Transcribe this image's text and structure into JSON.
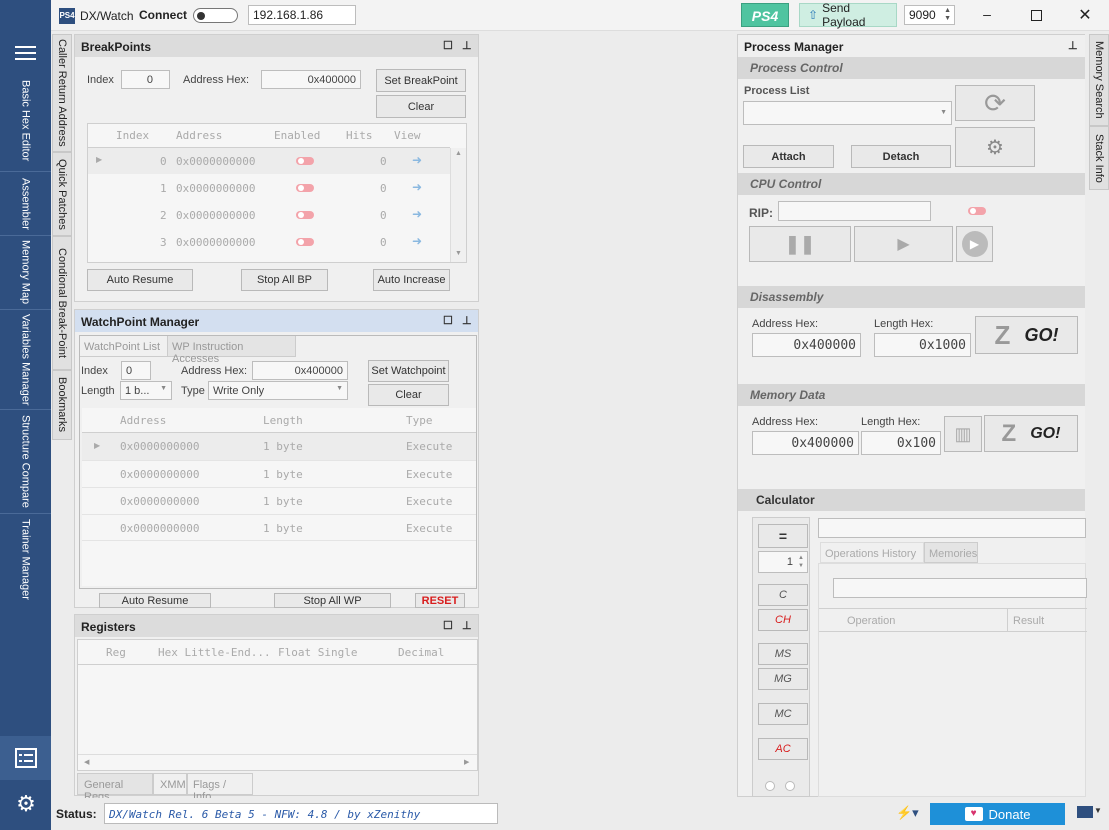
{
  "app": {
    "title": "DX/Watch",
    "logo_text": "PS4",
    "connect_label": "Connect",
    "ip": "192.168.1.86",
    "ps4_badge": "PS4",
    "send_payload": "Send Payload",
    "port": "9090"
  },
  "left_nav": {
    "items": [
      "Basic Hex Editor",
      "Assembler",
      "Memory Map",
      "Variables Manager",
      "Structure Compare",
      "Trainer Manager"
    ]
  },
  "side_tabs": [
    "Caller Return Address",
    "Quick Patches",
    "Condional Break-Point",
    "Bookmarks"
  ],
  "right_tabs": [
    "Memory Search",
    "Stack Info"
  ],
  "breakpoints": {
    "title": "BreakPoints",
    "index_label": "Index",
    "index_value": "0",
    "address_label": "Address Hex:",
    "address_value": "0x400000",
    "set_btn": "Set BreakPoint",
    "clear_btn": "Clear",
    "columns": [
      "Index",
      "Address",
      "Enabled",
      "Hits",
      "View"
    ],
    "rows": [
      {
        "index": "0",
        "address": "0x0000000000",
        "hits": "0"
      },
      {
        "index": "1",
        "address": "0x0000000000",
        "hits": "0"
      },
      {
        "index": "2",
        "address": "0x0000000000",
        "hits": "0"
      },
      {
        "index": "3",
        "address": "0x0000000000",
        "hits": "0"
      }
    ],
    "auto_resume": "Auto Resume",
    "stop_all": "Stop All BP",
    "auto_increase": "Auto Increase"
  },
  "watchpoints": {
    "title": "WatchPoint Manager",
    "tabs": [
      "WatchPoint List",
      "WP Instruction Accesses"
    ],
    "index_label": "Index",
    "index_value": "0",
    "address_label": "Address Hex:",
    "address_value": "0x400000",
    "length_label": "Length",
    "length_value": "1 b...",
    "type_label": "Type",
    "type_value": "Write Only",
    "set_btn": "Set Watchpoint",
    "clear_btn": "Clear",
    "columns": [
      "Address",
      "Length",
      "Type"
    ],
    "rows": [
      {
        "address": "0x0000000000",
        "length": "1 byte",
        "type": "Execute"
      },
      {
        "address": "0x0000000000",
        "length": "1 byte",
        "type": "Execute"
      },
      {
        "address": "0x0000000000",
        "length": "1 byte",
        "type": "Execute"
      },
      {
        "address": "0x0000000000",
        "length": "1 byte",
        "type": "Execute"
      }
    ],
    "auto_resume": "Auto Resume",
    "stop_all": "Stop All WP",
    "reset": "RESET"
  },
  "registers": {
    "title": "Registers",
    "columns": [
      "Reg",
      "Hex Little-End...",
      "Float Single",
      "Decimal"
    ],
    "tabs": [
      "General Regs",
      "XMM",
      "Flags / Info"
    ]
  },
  "process_manager": {
    "title": "Process Manager",
    "process_control": "Process Control",
    "process_list_label": "Process List",
    "attach": "Attach",
    "detach": "Detach",
    "cpu_control": "CPU Control",
    "rip_label": "RIP:",
    "disassembly": "Disassembly",
    "dis_addr_label": "Address Hex:",
    "dis_addr_value": "0x400000",
    "dis_len_label": "Length Hex:",
    "dis_len_value": "0x1000",
    "go": "GO!",
    "memory_data": "Memory Data",
    "mem_addr_label": "Address Hex:",
    "mem_addr_value": "0x400000",
    "mem_len_label": "Length Hex:",
    "mem_len_value": "0x100",
    "calculator": "Calculator",
    "calc_buttons": [
      "=",
      "C",
      "CH",
      "MS",
      "MG",
      "MC",
      "AC"
    ],
    "calc_spin": "1",
    "calc_tabs": [
      "Operations History",
      "Memories"
    ],
    "calc_columns": [
      "Operation",
      "Result"
    ]
  },
  "status": {
    "label": "Status:",
    "text": "DX/Watch  Rel. 6 Beta 5 - NFW: 4.8  /  by xZenithy",
    "donate": "Donate"
  },
  "colors": {
    "nav_bg": "#2e4f7f",
    "donate_bg": "#1e90d8",
    "reset_red": "#d81e1e",
    "ps4_badge": "#4fc4a0"
  }
}
